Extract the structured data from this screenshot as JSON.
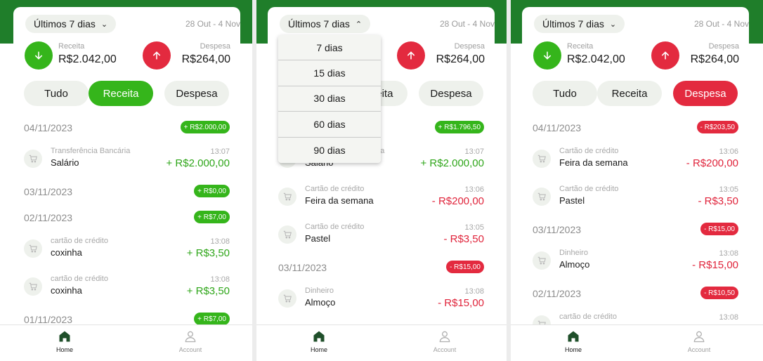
{
  "colors": {
    "brand_green": "#1f7e2a",
    "income_green": "#35b51b",
    "expense_red": "#e32a3f"
  },
  "screens": [
    {
      "period_label": "Últimos 7 dias",
      "period_chevron": "chevron-down-icon",
      "date_range": "28 Out - 4 Nov",
      "income_label": "Receita",
      "income_value": "R$2.042,00",
      "expense_label": "Despesa",
      "expense_value": "R$264,00",
      "filters": [
        "Tudo",
        "Receita",
        "Despesa"
      ],
      "active_filter": "Receita",
      "groups": [
        {
          "date": "04/11/2023",
          "total": "+ R$2.000,00",
          "type": "income",
          "items": [
            {
              "category": "Transferência Bancária",
              "name": "Salário",
              "time": "13:07",
              "amount": "+ R$2.000,00",
              "type": "income"
            }
          ]
        },
        {
          "date": "03/11/2023",
          "total": "+ R$0,00",
          "type": "income",
          "items": []
        },
        {
          "date": "02/11/2023",
          "total": "+ R$7,00",
          "type": "income",
          "items": [
            {
              "category": "cartão de crédito",
              "name": "coxinha",
              "time": "13:08",
              "amount": "+ R$3,50",
              "type": "income"
            },
            {
              "category": "cartão de crédito",
              "name": "coxinha",
              "time": "13:08",
              "amount": "+ R$3,50",
              "type": "income"
            }
          ]
        },
        {
          "date": "01/11/2023",
          "total": "+ R$7,00",
          "type": "income",
          "items": []
        }
      ],
      "nav": {
        "home": "Home",
        "account": "Account"
      }
    },
    {
      "period_label": "Últimos 7 dias",
      "period_chevron": "chevron-up-icon",
      "date_range": "28 Out - 4 Nov",
      "income_label": "Receita",
      "income_value": "R$2.042,00",
      "expense_label": "Despesa",
      "expense_value": "R$264,00",
      "filters": [
        "Tudo",
        "Receita",
        "Despesa"
      ],
      "active_filter": "",
      "groups": [
        {
          "date": "04/11/2023",
          "total": "+ R$1.796,50",
          "type": "income",
          "items": [
            {
              "category": "Transferência Bancária",
              "name": "Salário",
              "time": "13:07",
              "amount": "+ R$2.000,00",
              "type": "income"
            },
            {
              "category": "Cartão de crédito",
              "name": "Feira da semana",
              "time": "13:06",
              "amount": "- R$200,00",
              "type": "expense"
            },
            {
              "category": "Cartão de crédito",
              "name": "Pastel",
              "time": "13:05",
              "amount": "- R$3,50",
              "type": "expense"
            }
          ]
        },
        {
          "date": "03/11/2023",
          "total": "- R$15,00",
          "type": "expense",
          "items": [
            {
              "category": "Dinheiro",
              "name": "Almoço",
              "time": "13:08",
              "amount": "- R$15,00",
              "type": "expense"
            }
          ]
        }
      ],
      "dropdown": [
        "7 dias",
        "15 dias",
        "30 dias",
        "60 dias",
        "90 dias"
      ],
      "nav": {
        "home": "Home",
        "account": "Account"
      }
    },
    {
      "period_label": "Últimos 7 dias",
      "period_chevron": "chevron-down-icon",
      "date_range": "28 Out - 4 Nov",
      "income_label": "Receita",
      "income_value": "R$2.042,00",
      "expense_label": "Despesa",
      "expense_value": "R$264,00",
      "filters": [
        "Tudo",
        "Receita",
        "Despesa"
      ],
      "active_filter": "Despesa",
      "groups": [
        {
          "date": "04/11/2023",
          "total": "- R$203,50",
          "type": "expense",
          "items": [
            {
              "category": "Cartão de crédito",
              "name": "Feira da semana",
              "time": "13:06",
              "amount": "- R$200,00",
              "type": "expense"
            },
            {
              "category": "Cartão de crédito",
              "name": "Pastel",
              "time": "13:05",
              "amount": "- R$3,50",
              "type": "expense"
            }
          ]
        },
        {
          "date": "03/11/2023",
          "total": "- R$15,00",
          "type": "expense",
          "items": [
            {
              "category": "Dinheiro",
              "name": "Almoço",
              "time": "13:08",
              "amount": "- R$15,00",
              "type": "expense"
            }
          ]
        },
        {
          "date": "02/11/2023",
          "total": "- R$10,50",
          "type": "expense",
          "items": [
            {
              "category": "cartão de crédito",
              "name": "",
              "time": "13:08",
              "amount": "",
              "type": "expense"
            }
          ]
        }
      ],
      "nav": {
        "home": "Home",
        "account": "Account"
      }
    }
  ]
}
